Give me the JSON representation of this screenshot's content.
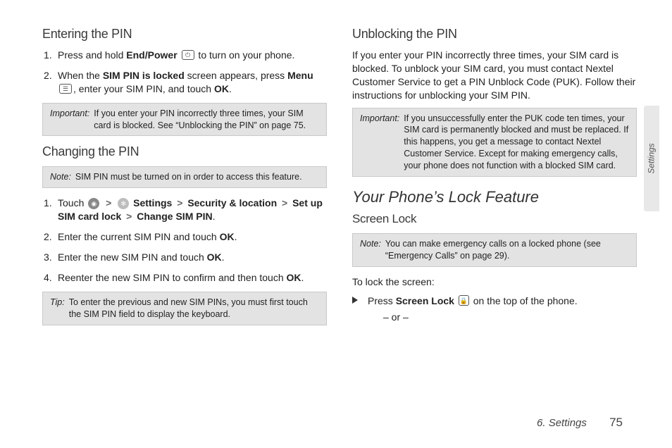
{
  "left": {
    "h_entering": "Entering the PIN",
    "step1_a": "Press and hold ",
    "step1_b": "End/Power",
    "step1_c": " to turn on your phone.",
    "step2_a": "When the ",
    "step2_b": "SIM PIN is locked",
    "step2_c": " screen appears, press ",
    "step2_d": "Menu",
    "step2_e": ", enter your SIM PIN, and touch ",
    "step2_f": "OK",
    "step2_g": ".",
    "imp1_lbl": "Important:",
    "imp1_body": "If you enter your PIN incorrectly three times, your SIM card is blocked. See “Unblocking the PIN” on page 75.",
    "h_changing": "Changing the PIN",
    "note1_lbl": "Note:",
    "note1_body": "SIM PIN must be turned on in order to access this feature.",
    "c1_a": "Touch  ",
    "c1_settings": "Settings",
    "c1_sec": "Security & location",
    "c1_setup": "Set up SIM card lock",
    "c1_change": "Change SIM PIN",
    "c1_dot": ".",
    "c2_a": "Enter the current SIM PIN and touch ",
    "c2_b": "OK",
    "c2_c": ".",
    "c3_a": "Enter the new SIM PIN and touch ",
    "c3_b": "OK",
    "c3_c": ".",
    "c4_a": "Reenter the new SIM PIN to confirm and then touch ",
    "c4_b": "OK",
    "c4_c": ".",
    "tip_lbl": "Tip:",
    "tip_body": "To enter the previous and new SIM PINs, you must first touch the SIM PIN field to display the keyboard."
  },
  "right": {
    "h_unblock": "Unblocking the PIN",
    "para_unblock": "If you enter your PIN incorrectly three times, your SIM card is blocked. To unblock your SIM card, you must contact Nextel Customer Service to get a PIN Unblock Code (PUK). Follow their instructions for unblocking your SIM PIN.",
    "imp2_lbl": "Important:",
    "imp2_body": "If you unsuccessfully enter the PUK code ten times, your SIM card is permanently blocked and must be replaced. If this happens, you get a message to contact Nextel Customer Service. Except for making emergency calls, your phone does not function with a blocked SIM card.",
    "h_lockfeat": "Your Phone’s Lock Feature",
    "h_screenlock": "Screen Lock",
    "note2_lbl": "Note:",
    "note2_body": "You can make emergency calls on a locked phone (see “Emergency Calls” on page 29).",
    "tolock": "To lock the screen:",
    "press_a": "Press ",
    "press_b": "Screen Lock",
    "press_c": " on the top of the phone.",
    "or": "– or –"
  },
  "tab": "Settings",
  "footer_chapter": "6. Settings",
  "footer_page": "75",
  "gt": ">",
  "icon_power": "⏻",
  "icon_menu": "☰",
  "icon_launcher": "●",
  "icon_gear": "⚙",
  "icon_lock": "ὑ2"
}
